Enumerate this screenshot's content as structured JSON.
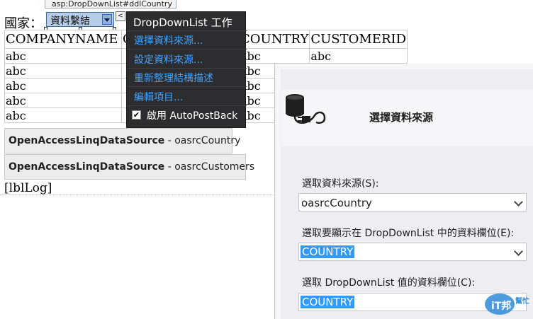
{
  "designer_tag": "asp:DropDownList#ddlCountry",
  "country_label": "國家：",
  "dropdown": {
    "value": "資料繫結",
    "smart_tag_glyph": "<"
  },
  "grid": {
    "headers": [
      "COMPANYNAME",
      "C",
      "COUNTRY",
      "CUSTOMERID"
    ],
    "rows": [
      [
        "abc",
        "",
        "abc",
        "abc"
      ],
      [
        "abc",
        "",
        "abc",
        ""
      ],
      [
        "abc",
        "",
        "abc",
        ""
      ],
      [
        "abc",
        "",
        "abc",
        ""
      ],
      [
        "abc",
        "",
        "abc",
        ""
      ]
    ]
  },
  "datasources": [
    {
      "type": "OpenAccessLinqDataSource",
      "id": " - oasrcCountry"
    },
    {
      "type": "OpenAccessLinqDataSource",
      "id": " - oasrcCustomers"
    }
  ],
  "lbl_log": "[lblLog]",
  "tasks_menu": {
    "title": "DropDownList 工作",
    "items": [
      "選擇資料來源...",
      "設定資料來源...",
      "重新整理結構描述",
      "編輯項目..."
    ],
    "autopostback_label": "啟用 AutoPostBack",
    "autopostback_checked": true,
    "check_glyph": "✔"
  },
  "wizard": {
    "title": "選擇資料來源",
    "source_label": "選取資料來源(S):",
    "source_value": "oasrcCountry",
    "display_field_label": "選取要顯示在 DropDownList 中的資料欄位(E):",
    "display_field_value": "COUNTRY",
    "value_field_label": "選取 DropDownList 值的資料欄位(C):",
    "value_field_value": "COUNTRY"
  },
  "watermark": {
    "line1": "iT邦",
    "line2": "幫忙"
  },
  "colors": {
    "menu_bg": "#2d2d30",
    "menu_link": "#3fa2ff",
    "selection": "#3399ff"
  }
}
